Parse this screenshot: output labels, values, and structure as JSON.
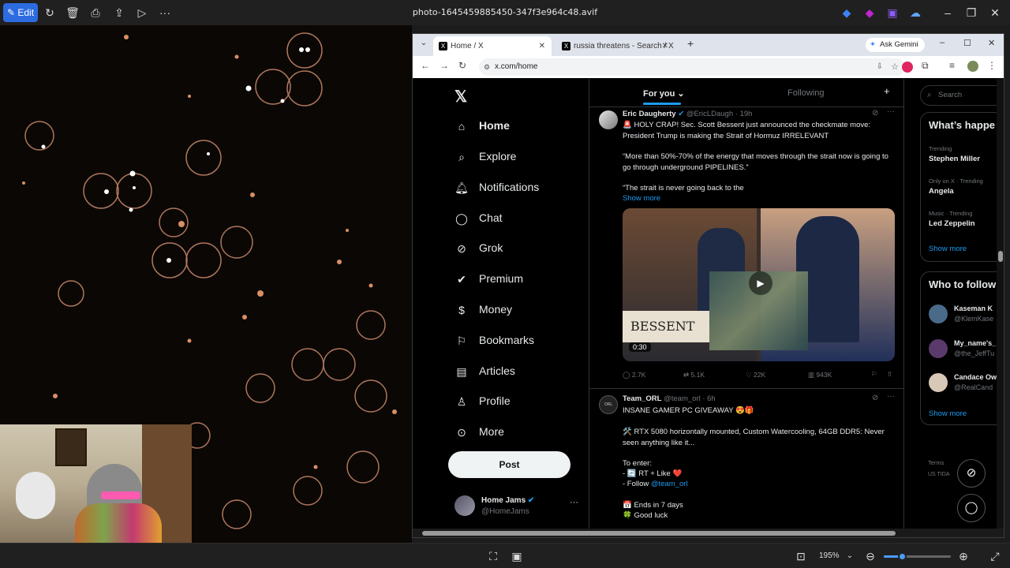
{
  "viewer": {
    "edit_label": "Edit",
    "title": "photo-1645459885450-347f3e964c48.avif",
    "zoom": "195%"
  },
  "browser": {
    "tabs": [
      {
        "label": "Home / X"
      },
      {
        "label": "russia threatens - Search / X"
      }
    ],
    "ask_gemini": "Ask Gemini",
    "url": "x.com/home"
  },
  "x": {
    "nav": [
      {
        "label": "Home",
        "icon": "home-icon"
      },
      {
        "label": "Explore",
        "icon": "search-icon"
      },
      {
        "label": "Notifications",
        "icon": "bell-icon"
      },
      {
        "label": "Chat",
        "icon": "chat-icon"
      },
      {
        "label": "Grok",
        "icon": "grok-icon"
      },
      {
        "label": "Premium",
        "icon": "premium-icon"
      },
      {
        "label": "Money",
        "icon": "money-icon"
      },
      {
        "label": "Bookmarks",
        "icon": "bookmark-icon"
      },
      {
        "label": "Articles",
        "icon": "articles-icon"
      },
      {
        "label": "Profile",
        "icon": "profile-icon"
      },
      {
        "label": "More",
        "icon": "more-icon"
      }
    ],
    "post_label": "Post",
    "account": {
      "name": "Home Jams",
      "handle": "@HomeJams"
    },
    "feed_tabs": {
      "for_you": "For you",
      "following": "Following"
    },
    "tweets": [
      {
        "name": "Eric Daugherty",
        "handle": "@EricLDaugh",
        "time": "· 19h",
        "text1": "🚨 HOLY CRAP! Sec. Scott Bessent just announced the checkmate move: President Trump is making the Strait of Hormuz IRRELEVANT",
        "text2": "“More than 50%-70% of the energy that moves through the strait now is going to go through underground PIPELINES.”",
        "text3": "“The strait is never going back to the",
        "show_more": "Show more",
        "video_duration": "0:30",
        "replies": "2.7K",
        "reposts": "5.1K",
        "likes": "22K",
        "views": "943K"
      },
      {
        "name": "Team_ORL",
        "handle": "@team_orl",
        "time": "· 6h",
        "text1": "INSANE GAMER PC GIVEAWAY 😍🎁",
        "text2": "🛠️ RTX 5080 horizontally mounted, Custom Watercooling, 64GB DDR5: Never seen anything like it...",
        "text3": "To enter:",
        "entry1": "- 🔄 RT + Like ❤️",
        "entry2_prefix": "- Follow ",
        "entry2_link": "@team_orl",
        "ends": "📅 Ends in 7 days",
        "luck": "🍀 Good luck"
      }
    ],
    "search_placeholder": "Search",
    "whats_happening": "What’s happe",
    "trends": [
      {
        "meta": "Trending",
        "name": "Stephen Miller"
      },
      {
        "meta": "Only on X · Trending",
        "name": "Angela"
      },
      {
        "meta": "Music · Trending",
        "name": "Led Zeppelin"
      }
    ],
    "show_more": "Show more",
    "who_to_follow": "Who to follow",
    "follow": [
      {
        "name": "Kaseman K",
        "handle": "@KlemKase"
      },
      {
        "name": "My_name's_",
        "handle": "@the_JeffTu"
      },
      {
        "name": "Candace Ow",
        "handle": "@RealCand"
      }
    ],
    "show_more_2": "Show more",
    "footer_terms": "Terms",
    "footer_region": "US TIDA"
  },
  "colors": {
    "accent": "#1d9bf0",
    "edit_blue": "#2d6be0"
  }
}
